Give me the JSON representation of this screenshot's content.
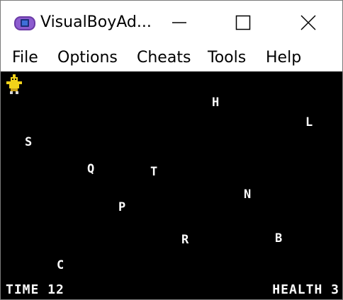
{
  "window": {
    "title": "VisualBoyAd...",
    "icon": "gameboy-advance-icon",
    "controls": [
      "minimize-icon",
      "maximize-icon",
      "close-icon"
    ]
  },
  "menu": {
    "file": "File",
    "options": "Options",
    "cheats": "Cheats",
    "tools": "Tools",
    "help": "Help"
  },
  "game": {
    "player_icon": "yellow-bird-sprite",
    "letters": {
      "h": "H",
      "l": "L",
      "s": "S",
      "q": "Q",
      "t": "T",
      "n": "N",
      "p": "P",
      "r": "R",
      "b": "B",
      "c": "C"
    },
    "hud": {
      "time": "TIME 12",
      "health": "HEALTH 3"
    }
  },
  "colors": {
    "screen_bg": "#000000",
    "text": "#ffffff",
    "player": "#f2d21a"
  }
}
